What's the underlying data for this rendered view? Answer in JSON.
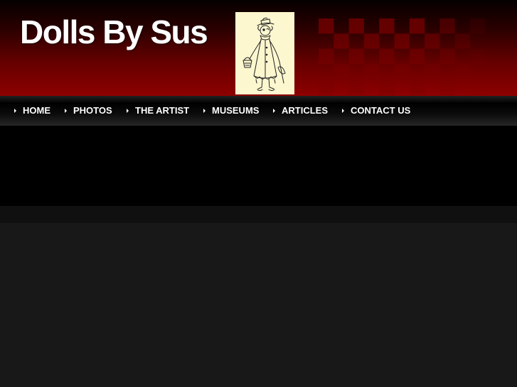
{
  "header": {
    "site_title": "Dolls By Sus",
    "logo_icon": "doll-sketch-icon",
    "colors": {
      "header_top": "#050000",
      "header_bottom": "#8e0000",
      "checker": "#7a0000",
      "logo_background": "#fcf7cf"
    }
  },
  "nav": {
    "items": [
      {
        "label": "HOME"
      },
      {
        "label": "PHOTOS"
      },
      {
        "label": "THE ARTIST"
      },
      {
        "label": "MUSEUMS"
      },
      {
        "label": "ARTICLES"
      },
      {
        "label": "CONTACT US"
      }
    ],
    "bullet_icon": "triangle-bullet-icon"
  },
  "page": {
    "colors": {
      "banner": "#000000",
      "body_background": "#181818"
    }
  }
}
